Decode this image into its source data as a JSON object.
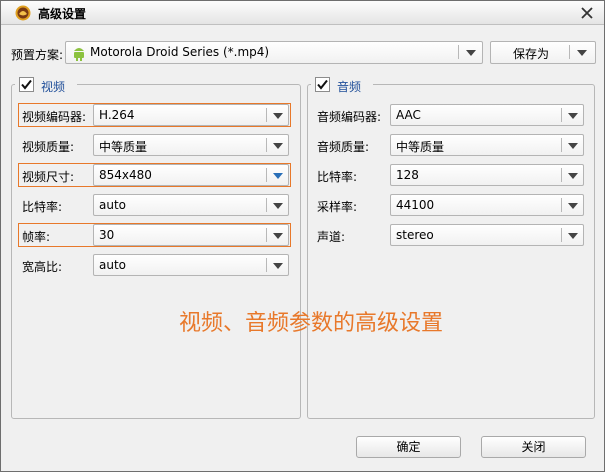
{
  "window": {
    "title": "高级设置"
  },
  "icons": {
    "app": "game-controller-icon",
    "close": "close-icon",
    "device": "android-icon",
    "check": "checkmark-icon",
    "dropdown": "chevron-down-icon"
  },
  "preset": {
    "label": "预置方案:",
    "value": "Motorola Droid Series (*.mp4)",
    "save_as": "保存为"
  },
  "video": {
    "title": "视频",
    "checked": true,
    "rows": [
      {
        "label": "视频编码器:",
        "value": "H.264"
      },
      {
        "label": "视频质量:",
        "value": "中等质量"
      },
      {
        "label": "视频尺寸:",
        "value": "854x480"
      },
      {
        "label": "比特率:",
        "value": "auto"
      },
      {
        "label": "帧率:",
        "value": "30"
      },
      {
        "label": "宽高比:",
        "value": "auto"
      }
    ]
  },
  "audio": {
    "title": "音频",
    "checked": true,
    "rows": [
      {
        "label": "音频编码器:",
        "value": "AAC"
      },
      {
        "label": "音频质量:",
        "value": "中等质量"
      },
      {
        "label": "比特率:",
        "value": "128"
      },
      {
        "label": "采样率:",
        "value": "44100"
      },
      {
        "label": "声道:",
        "value": "stereo"
      }
    ]
  },
  "annotation": "视频、音频参数的高级设置",
  "buttons": {
    "ok": "确定",
    "close": "关闭"
  },
  "colors": {
    "highlight": "#e8782a",
    "group_title": "#1f4e99",
    "annotation": "#e8782a"
  }
}
